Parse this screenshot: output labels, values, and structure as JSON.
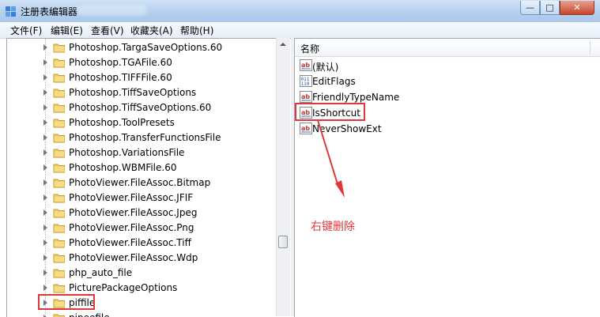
{
  "window": {
    "title": "注册表编辑器"
  },
  "menu": [
    {
      "label": "文件(F)"
    },
    {
      "label": "编辑(E)"
    },
    {
      "label": "查看(V)"
    },
    {
      "label": "收藏夹(A)"
    },
    {
      "label": "帮助(H)"
    }
  ],
  "tree": {
    "items": [
      {
        "label": "Photoshop.TargaSaveOptions.60"
      },
      {
        "label": "Photoshop.TGAFile.60"
      },
      {
        "label": "Photoshop.TIFFFile.60"
      },
      {
        "label": "Photoshop.TiffSaveOptions"
      },
      {
        "label": "Photoshop.TiffSaveOptions.60"
      },
      {
        "label": "Photoshop.ToolPresets"
      },
      {
        "label": "Photoshop.TransferFunctionsFile"
      },
      {
        "label": "Photoshop.VariationsFile"
      },
      {
        "label": "Photoshop.WBMFile.60"
      },
      {
        "label": "PhotoViewer.FileAssoc.Bitmap"
      },
      {
        "label": "PhotoViewer.FileAssoc.JFIF"
      },
      {
        "label": "PhotoViewer.FileAssoc.Jpeg"
      },
      {
        "label": "PhotoViewer.FileAssoc.Png"
      },
      {
        "label": "PhotoViewer.FileAssoc.Tiff"
      },
      {
        "label": "PhotoViewer.FileAssoc.Wdp"
      },
      {
        "label": "php_auto_file"
      },
      {
        "label": "PicturePackageOptions"
      },
      {
        "label": "piffile"
      },
      {
        "label": "pipeefile"
      }
    ]
  },
  "values_pane": {
    "column_header": "名称",
    "items": [
      {
        "label": "(默认)",
        "icon": "string-value-icon"
      },
      {
        "label": "EditFlags",
        "icon": "binary-value-icon"
      },
      {
        "label": "FriendlyTypeName",
        "icon": "string-value-icon"
      },
      {
        "label": "IsShortcut",
        "icon": "string-value-icon"
      },
      {
        "label": "NeverShowExt",
        "icon": "string-value-icon"
      }
    ]
  },
  "annotation": {
    "text": "右键删除",
    "color": "#e0383a"
  },
  "colors": {
    "highlight": "#e0383a",
    "folder": "#e8c25a",
    "titlebar": "#b8d2ee"
  }
}
